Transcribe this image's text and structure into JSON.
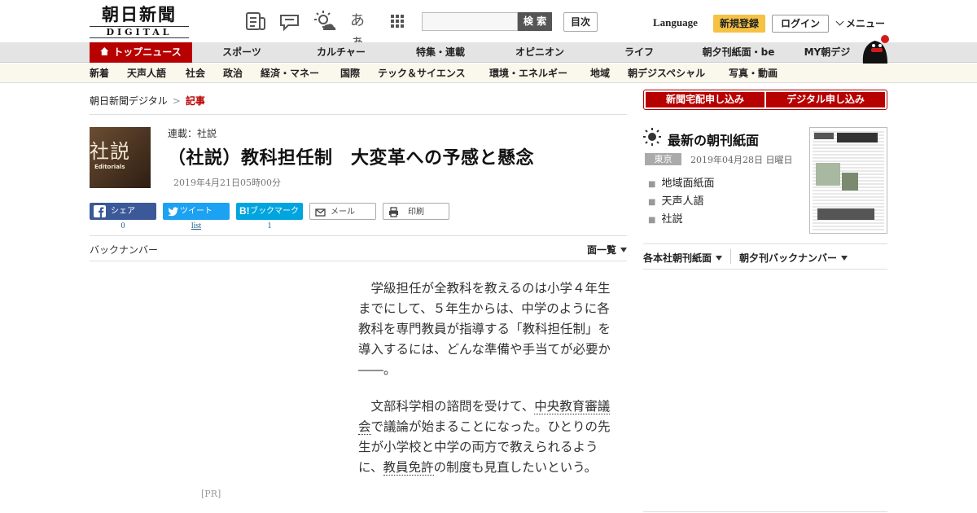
{
  "header": {
    "logo": {
      "jp": "朝日新聞",
      "en": "DIGITAL"
    },
    "hiragana_icon": "あぁ",
    "search_placeholder": "",
    "search_button": "検 索",
    "toc_button": "目次",
    "language": "Language",
    "register": "新規登録",
    "login": "ログイン",
    "menu": "メニュー"
  },
  "main_nav": [
    "トップニュース",
    "スポーツ",
    "カルチャー",
    "特集・連載",
    "オピニオン",
    "ライフ",
    "朝夕刊紙面・be",
    "MY朝デジ"
  ],
  "sub_nav": [
    "新着",
    "天声人語",
    "社会",
    "政治",
    "経済・マネー",
    "国際",
    "テック＆サイエンス",
    "環境・エネルギー",
    "地域",
    "朝デジスペシャル",
    "写真・動画"
  ],
  "breadcrumb": {
    "home": "朝日新聞デジタル",
    "sep": ">",
    "current": "記事"
  },
  "article": {
    "thumb_kanji": "社説",
    "thumb_en": "Editorials",
    "series": "連載：社説",
    "headline": "（社説）教科担任制　大変革への予感と懸念",
    "date": "2019年4月21日05時00分",
    "back_number": "バックナンバー",
    "page_list": "面一覧",
    "pr": "[PR]",
    "p1": "学級担任が全教科を教えるのは小学４年生までにして、５年生からは、中学のように各教科を専門教員が指導する「教科担任制」を導入するには、どんな準備や手当てが必要か――。",
    "p2_a": "文部科学相の諮問を受けて、",
    "p2_term1": "中央教育審議会",
    "p2_b": "で議論が始まることになった。ひとりの先生が小学校と中学の両方で教えられるように、",
    "p2_term2": "教員免許",
    "p2_c": "の制度も見直したいという。"
  },
  "share": {
    "facebook": {
      "label": "シェア",
      "count": "0"
    },
    "twitter": {
      "label": "ツイート",
      "count": "list"
    },
    "hatena": {
      "label": "ブックマーク",
      "count": "1"
    },
    "mail": {
      "label": "メール"
    },
    "print": {
      "label": "印刷"
    }
  },
  "sidebar": {
    "subscribe_paper": "新聞宅配申し込み",
    "subscribe_digital": "デジタル申し込み",
    "latest_title": "最新の朝刊紙面",
    "region": "東京",
    "paper_date": "2019年04月28日 日曜日",
    "links": [
      "地域面紙面",
      "天声人語",
      "社説"
    ],
    "editions": "各本社朝刊紙面",
    "back_issues": "朝夕刊バックナンバー"
  },
  "colors": {
    "brand_red": "#b70000",
    "facebook": "#3b5998",
    "twitter": "#1da1f2",
    "hatena": "#00a4de",
    "register_yellow": "#f6c244"
  }
}
